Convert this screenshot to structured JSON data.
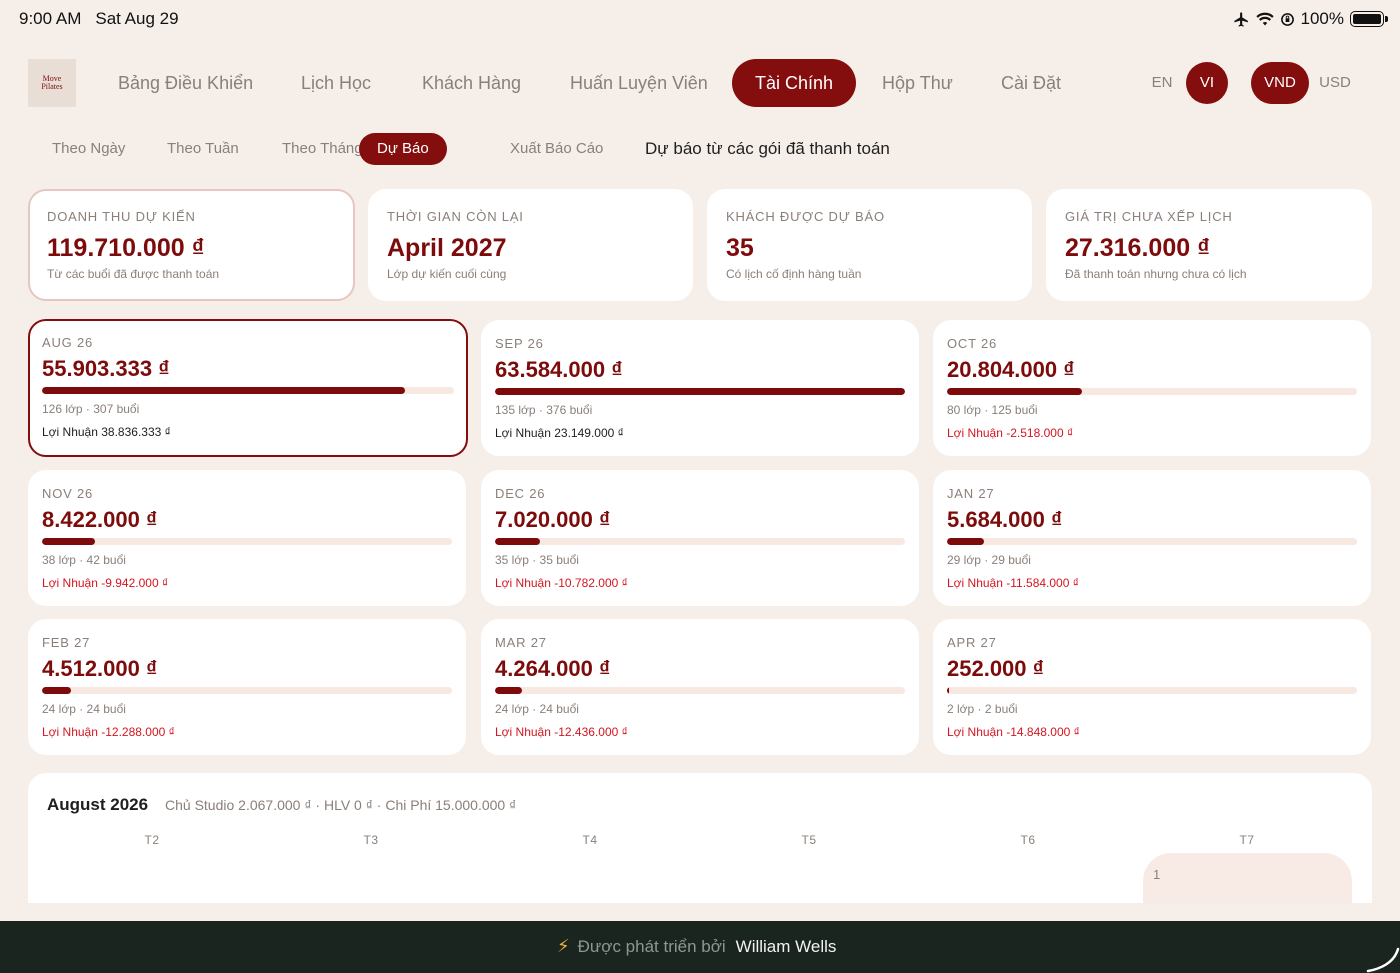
{
  "status_bar": {
    "time": "9:00 AM",
    "date": "Sat Aug 29",
    "battery": "100%",
    "icons": [
      "airplane-icon",
      "wifi-icon",
      "screen-lock-icon",
      "battery-icon"
    ]
  },
  "brand": {
    "line1": "Move",
    "line2": "Pilates"
  },
  "nav": {
    "items": [
      "Bảng Điều Khiển",
      "Lịch Học",
      "Khách Hàng",
      "Huấn Luyện Viên",
      "Tài Chính",
      "Hộp Thư",
      "Cài Đặt"
    ],
    "active": "Tài Chính"
  },
  "lang": {
    "en": "EN",
    "vi": "VI",
    "active": "VI"
  },
  "currency": {
    "vnd": "VND",
    "usd": "USD",
    "active": "VND"
  },
  "subnav": {
    "items": [
      "Theo Ngày",
      "Theo Tuần",
      "Theo Tháng",
      "Dự Báo",
      "Xuất Báo Cáo"
    ],
    "active": "Dự Báo",
    "description": "Dự báo từ các gói đã thanh toán"
  },
  "summary": [
    {
      "label": "DOANH THU DỰ KIẾN",
      "value": "119.710.000 ₫",
      "sub": "Từ các buổi đã được thanh toán"
    },
    {
      "label": "THỜI GIAN CÒN LẠI",
      "value": "April 2027",
      "sub": "Lớp dự kiến cuối cùng"
    },
    {
      "label": "KHÁCH ĐƯỢC DỰ BÁO",
      "value": "35",
      "sub": "Có lịch cố định hàng tuần"
    },
    {
      "label": "GIÁ TRỊ CHƯA XẾP LỊCH",
      "value": "27.316.000 ₫",
      "sub": "Đã thanh toán nhưng chưa có lịch"
    }
  ],
  "months": [
    {
      "label": "AUG 26",
      "value": "55.903.333 ₫",
      "progress": 0.88,
      "sub": "126 lớp · 307 buổi",
      "profit": "Lợi Nhuận 38.836.333 ₫",
      "negative": false
    },
    {
      "label": "SEP 26",
      "value": "63.584.000 ₫",
      "progress": 1.0,
      "sub": "135 lớp · 376 buổi",
      "profit": "Lợi Nhuận 23.149.000 ₫",
      "negative": false
    },
    {
      "label": "OCT 26",
      "value": "20.804.000 ₫",
      "progress": 0.33,
      "sub": "80 lớp · 125 buổi",
      "profit": "Lợi Nhuận -2.518.000 ₫",
      "negative": true
    },
    {
      "label": "NOV 26",
      "value": "8.422.000 ₫",
      "progress": 0.13,
      "sub": "38 lớp · 42 buổi",
      "profit": "Lợi Nhuận -9.942.000 ₫",
      "negative": true
    },
    {
      "label": "DEC 26",
      "value": "7.020.000 ₫",
      "progress": 0.11,
      "sub": "35 lớp · 35 buổi",
      "profit": "Lợi Nhuận -10.782.000 ₫",
      "negative": true
    },
    {
      "label": "JAN 27",
      "value": "5.684.000 ₫",
      "progress": 0.09,
      "sub": "29 lớp · 29 buổi",
      "profit": "Lợi Nhuận -11.584.000 ₫",
      "negative": true
    },
    {
      "label": "FEB 27",
      "value": "4.512.000 ₫",
      "progress": 0.07,
      "sub": "24 lớp · 24 buổi",
      "profit": "Lợi Nhuận -12.288.000 ₫",
      "negative": true
    },
    {
      "label": "MAR 27",
      "value": "4.264.000 ₫",
      "progress": 0.067,
      "sub": "24 lớp · 24 buổi",
      "profit": "Lợi Nhuận -12.436.000 ₫",
      "negative": true
    },
    {
      "label": "APR 27",
      "value": "252.000 ₫",
      "progress": 0.004,
      "sub": "2 lớp · 2 buổi",
      "profit": "Lợi Nhuận -14.848.000 ₫",
      "negative": true
    }
  ],
  "calendar": {
    "title": "August 2026",
    "meta": "Chủ Studio 2.067.000 ₫ · HLV 0 ₫ · Chi Phí 15.000.000 ₫",
    "weekdays": [
      "T2",
      "T3",
      "T4",
      "T5",
      "T6",
      "T7"
    ],
    "first_day": "1"
  },
  "footer": {
    "text": "Được phát triển bởi",
    "name": "William Wells"
  },
  "colors": {
    "accent": "#840d0d",
    "background": "#f6efe9",
    "negative": "#d4161f",
    "footer": "#1b2520"
  }
}
